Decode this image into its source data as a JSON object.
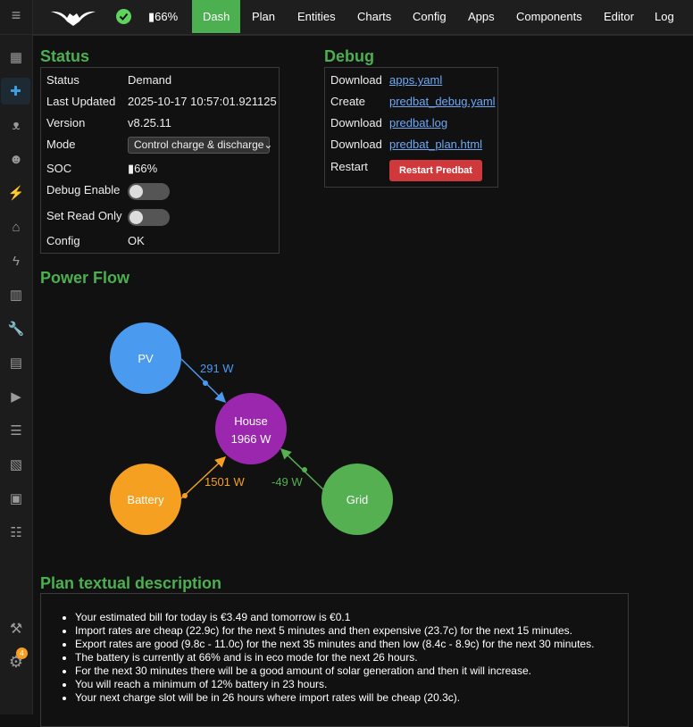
{
  "topbar": {
    "battery": "66%",
    "nav": [
      "Dash",
      "Plan",
      "Entities",
      "Charts",
      "Config",
      "Apps",
      "Components",
      "Editor",
      "Log"
    ],
    "active": "Dash"
  },
  "sidebar": {
    "icons": [
      "dashboard-icon",
      "puzzle-icon",
      "bat-icon",
      "robot-icon",
      "ev-charger-icon",
      "home-icon",
      "lightning-icon",
      "chart-icon",
      "wrench-icon",
      "hacs-icon",
      "media-icon",
      "database-icon",
      "clipboard-icon",
      "person-board-icon",
      "list-icon"
    ],
    "badge": "4"
  },
  "status": {
    "title": "Status",
    "rows": [
      {
        "label": "Status",
        "value": "Demand"
      },
      {
        "label": "Last Updated",
        "value": "2025-10-17 10:57:01.921125"
      },
      {
        "label": "Version",
        "value": "v8.25.11"
      },
      {
        "label": "Mode",
        "value": "Control charge & discharge"
      },
      {
        "label": "SOC",
        "value": "66%"
      },
      {
        "label": "Debug Enable",
        "value": false
      },
      {
        "label": "Set Read Only",
        "value": false
      },
      {
        "label": "Config",
        "value": "OK"
      }
    ]
  },
  "debug": {
    "title": "Debug",
    "rows": [
      {
        "label": "Download",
        "link": "apps.yaml"
      },
      {
        "label": "Create",
        "link": "predbat_debug.yaml"
      },
      {
        "label": "Download",
        "link": "predbat.log"
      },
      {
        "label": "Download",
        "link": "predbat_plan.html"
      },
      {
        "label": "Restart",
        "button": "Restart Predbat"
      }
    ]
  },
  "power_flow": {
    "title": "Power Flow",
    "pv": {
      "label": "PV",
      "flow": "291 W",
      "color": "#4a9af0"
    },
    "house": {
      "label": "House",
      "value": "1966 W",
      "color": "#9b27af"
    },
    "battery": {
      "label": "Battery",
      "flow": "1501 W",
      "color": "#f5a020"
    },
    "grid": {
      "label": "Grid",
      "flow": "-49 W",
      "color": "#55b052"
    }
  },
  "plan": {
    "title": "Plan textual description",
    "items": [
      "Your estimated bill for today is €3.49 and tomorrow is €0.1",
      "Import rates are cheap (22.9c) for the next 5 minutes and then expensive (23.7c) for the next 15 minutes.",
      "Export rates are good (9.8c - 11.0c) for the next 35 minutes and then low (8.4c - 8.9c) for the next 30 minutes.",
      "The battery is currently at 66% and is in eco mode for the next 26 hours.",
      "For the next 30 minutes there will be a good amount of solar generation and then it will increase.",
      "You will reach a minimum of 12% battery in 23 hours.",
      "Your next charge slot will be in 26 hours where import rates will be cheap (20.3c)."
    ]
  }
}
